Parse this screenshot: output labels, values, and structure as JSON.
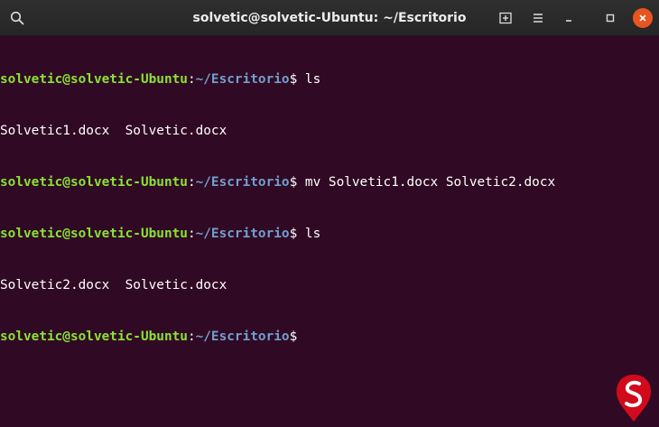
{
  "window": {
    "title": "solvetic@solvetic-Ubuntu: ~/Escritorio"
  },
  "titlebar_icons": {
    "search": "search-icon",
    "new_tab": "new-tab-icon",
    "menu": "hamburger-menu-icon",
    "minimize": "minimize-icon",
    "maximize": "maximize-icon",
    "close": "close-icon"
  },
  "colors": {
    "background": "#300a24",
    "prompt_user": "#8ae234",
    "prompt_path": "#729fcf",
    "text": "#ffffff",
    "close_button": "#e95420"
  },
  "terminal": {
    "lines": [
      {
        "type": "prompt",
        "user": "solvetic@solvetic-Ubuntu",
        "sep": ":",
        "path": "~/Escritorio",
        "symbol": "$",
        "command": " ls"
      },
      {
        "type": "output",
        "text": "Solvetic1.docx  Solvetic.docx"
      },
      {
        "type": "prompt",
        "user": "solvetic@solvetic-Ubuntu",
        "sep": ":",
        "path": "~/Escritorio",
        "symbol": "$",
        "command": " mv Solvetic1.docx Solvetic2.docx"
      },
      {
        "type": "prompt",
        "user": "solvetic@solvetic-Ubuntu",
        "sep": ":",
        "path": "~/Escritorio",
        "symbol": "$",
        "command": " ls"
      },
      {
        "type": "output",
        "text": "Solvetic2.docx  Solvetic.docx"
      },
      {
        "type": "prompt",
        "user": "solvetic@solvetic-Ubuntu",
        "sep": ":",
        "path": "~/Escritorio",
        "symbol": "$",
        "command": ""
      }
    ]
  },
  "watermark": {
    "icon": "solvetic-logo-icon"
  }
}
